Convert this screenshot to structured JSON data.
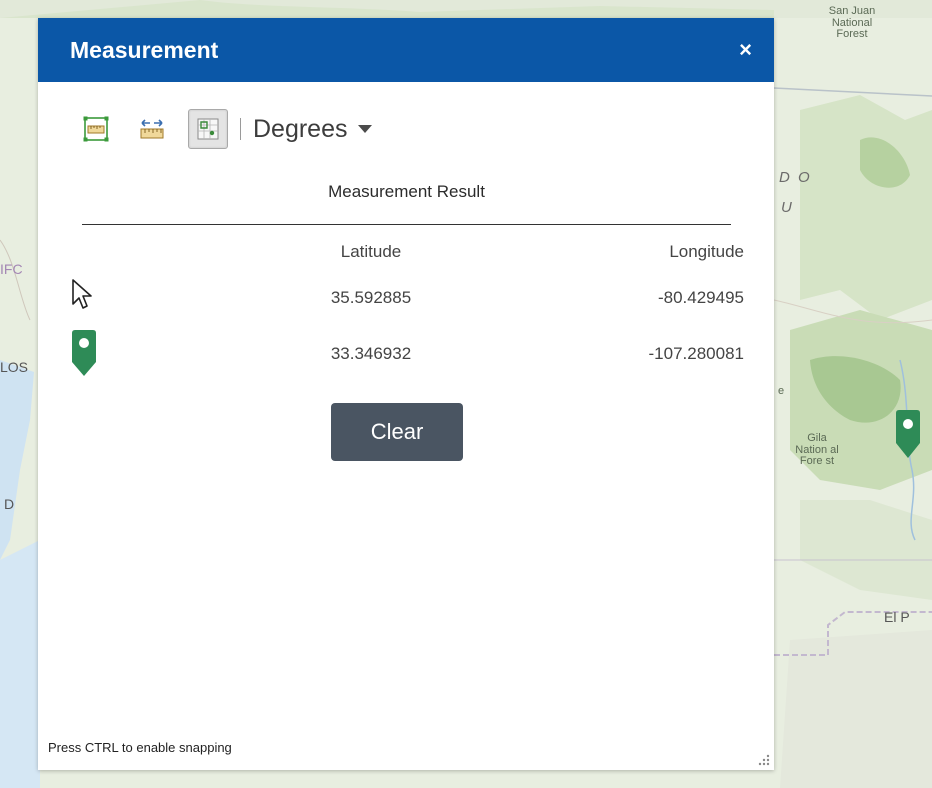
{
  "map": {
    "labels": {
      "forest_top": [
        "San Juan",
        "National",
        "Forest"
      ],
      "state_top": "D O",
      "state_bottom": "U",
      "gila": [
        "Gila",
        "Nation al",
        "Fore st"
      ],
      "el_paso": "El P",
      "left_ifo": "IFC",
      "left_los": "LOS",
      "left_d": "D",
      "left_e": "e"
    }
  },
  "panel": {
    "title": "Measurement",
    "close_label": "×",
    "toolbar": {
      "tools": [
        {
          "name": "area-tool",
          "icon": "area-ruler-icon",
          "active": false
        },
        {
          "name": "distance-tool",
          "icon": "distance-ruler-icon",
          "active": false
        },
        {
          "name": "location-tool",
          "icon": "location-grid-icon",
          "active": true
        }
      ],
      "unit": "Degrees"
    },
    "result": {
      "title": "Measurement Result",
      "headers": {
        "latitude": "Latitude",
        "longitude": "Longitude"
      },
      "rows": [
        {
          "icon": "cursor-icon",
          "latitude": "35.592885",
          "longitude": "-80.429495"
        },
        {
          "icon": "green-pin-icon",
          "latitude": "33.346932",
          "longitude": "-107.280081"
        }
      ]
    },
    "clear_label": "Clear",
    "footer": "Press CTRL to enable snapping"
  },
  "colors": {
    "header": "#0b57a7",
    "clear_button": "#4a5562",
    "pin": "#2e8b57"
  }
}
